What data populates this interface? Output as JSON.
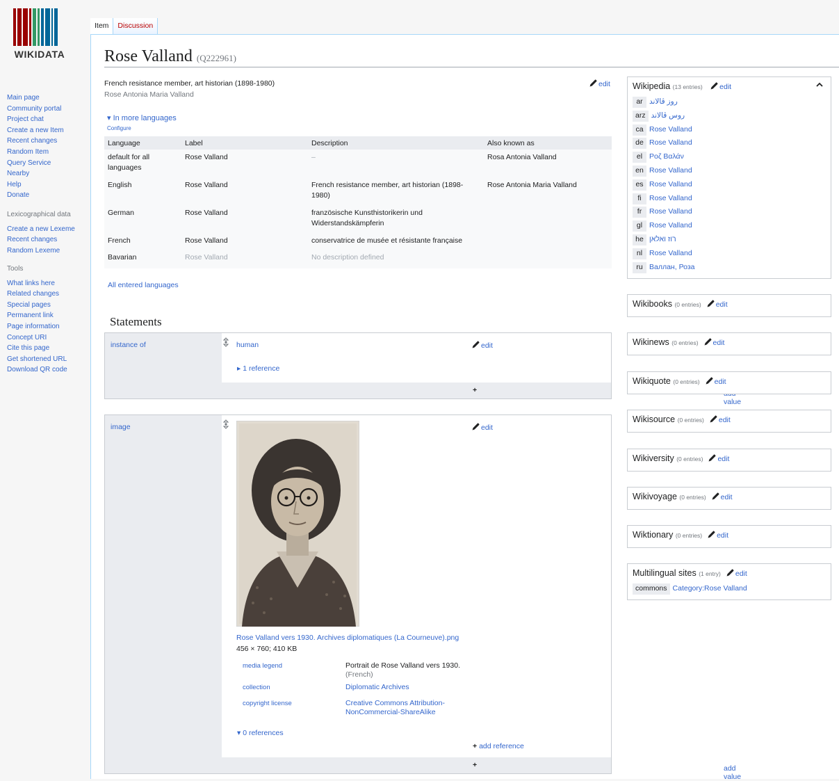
{
  "logo": {
    "text": "WIKIDATA",
    "bar_colors": [
      "#990000",
      "#990000",
      "#990000",
      "#990000",
      "#339966",
      "#339966",
      "#006699",
      "#006699",
      "#006699",
      "#006699"
    ]
  },
  "nav": {
    "main": [
      "Main page",
      "Community portal",
      "Project chat",
      "Create a new Item",
      "Recent changes",
      "Random Item",
      "Query Service",
      "Nearby",
      "Help",
      "Donate"
    ],
    "lex_heading": "Lexicographical data",
    "lex": [
      "Create a new Lexeme",
      "Recent changes",
      "Random Lexeme"
    ],
    "tools_heading": "Tools",
    "tools": [
      "What links here",
      "Related changes",
      "Special pages",
      "Permanent link",
      "Page information",
      "Concept URI",
      "Cite this page",
      "Get shortened URL",
      "Download QR code"
    ]
  },
  "tabs": {
    "item": "Item",
    "discussion": "Discussion"
  },
  "title": {
    "label": "Rose Valland",
    "qid": "(Q222961)"
  },
  "fingerprint": {
    "description": "French resistance member, art historian (1898-1980)",
    "alias": "Rose Antonia Maria Valland",
    "edit": "edit",
    "more_languages": "In more languages",
    "configure": "Configure",
    "all_languages": "All entered languages"
  },
  "lang_table": {
    "headers": [
      "Language",
      "Label",
      "Description",
      "Also known as"
    ],
    "rows": [
      {
        "lang": "default for all languages",
        "label": "Rose Valland",
        "desc": "–",
        "aka": "Rosa Antonia Valland"
      },
      {
        "lang": "English",
        "label": "Rose Valland",
        "desc": "French resistance member, art historian (1898-1980)",
        "aka": "Rose Antonia Maria Valland"
      },
      {
        "lang": "German",
        "label": "Rose Valland",
        "desc": "französische Kunsthistorikerin und Widerstandskämpferin",
        "aka": ""
      },
      {
        "lang": "French",
        "label": "Rose Valland",
        "desc": "conservatrice de musée et résistante française",
        "aka": ""
      },
      {
        "lang": "Bavarian",
        "label": "Rose Valland",
        "desc": "No description defined",
        "aka": ""
      }
    ]
  },
  "statements": {
    "heading": "Statements",
    "s1": {
      "property": "instance of",
      "value": "human",
      "edit": "edit",
      "refs": "1 reference",
      "add_value": "add value"
    },
    "s2": {
      "property": "image",
      "edit": "edit",
      "filename": "Rose Valland vers 1930. Archives diplomatiques (La Courneuve).png",
      "fileinfo": "456 × 760; 410 KB",
      "q1_prop": "media legend",
      "q1_val": "Portrait de Rose Valland vers 1930.",
      "q1_lang": "(French)",
      "q2_prop": "collection",
      "q2_val": "Diplomatic Archives",
      "q3_prop": "copyright license",
      "q3_val": "Creative Commons Attribution-NonCommercial-ShareAlike",
      "refs": "0 references",
      "add_reference": "add reference",
      "add_value": "add value"
    }
  },
  "sitelinks": {
    "wikipedia": {
      "title": "Wikipedia",
      "count": "(13 entries)",
      "edit": "edit",
      "links": [
        {
          "code": "ar",
          "title": "روز ڤالاند"
        },
        {
          "code": "arz",
          "title": "روس ڤالاند"
        },
        {
          "code": "ca",
          "title": "Rose Valland"
        },
        {
          "code": "de",
          "title": "Rose Valland"
        },
        {
          "code": "el",
          "title": "Ροζ Βαλάν"
        },
        {
          "code": "en",
          "title": "Rose Valland"
        },
        {
          "code": "es",
          "title": "Rose Valland"
        },
        {
          "code": "fi",
          "title": "Rose Valland"
        },
        {
          "code": "fr",
          "title": "Rose Valland"
        },
        {
          "code": "gl",
          "title": "Rose Valland"
        },
        {
          "code": "he",
          "title": "רוז ואלאן"
        },
        {
          "code": "nl",
          "title": "Rose Valland"
        },
        {
          "code": "ru",
          "title": "Валлан, Роза"
        }
      ]
    },
    "wikibooks": {
      "title": "Wikibooks",
      "count": "(0 entries)",
      "edit": "edit"
    },
    "wikinews": {
      "title": "Wikinews",
      "count": "(0 entries)",
      "edit": "edit"
    },
    "wikiquote": {
      "title": "Wikiquote",
      "count": "(0 entries)",
      "edit": "edit"
    },
    "wikisource": {
      "title": "Wikisource",
      "count": "(0 entries)",
      "edit": "edit"
    },
    "wikiversity": {
      "title": "Wikiversity",
      "count": "(0 entries)",
      "edit": "edit"
    },
    "wikivoyage": {
      "title": "Wikivoyage",
      "count": "(0 entries)",
      "edit": "edit"
    },
    "wiktionary": {
      "title": "Wiktionary",
      "count": "(0 entries)",
      "edit": "edit"
    },
    "multilingual": {
      "title": "Multilingual sites",
      "count": "(1 entry)",
      "edit": "edit",
      "code": "commons",
      "link": "Category:Rose Valland"
    }
  }
}
